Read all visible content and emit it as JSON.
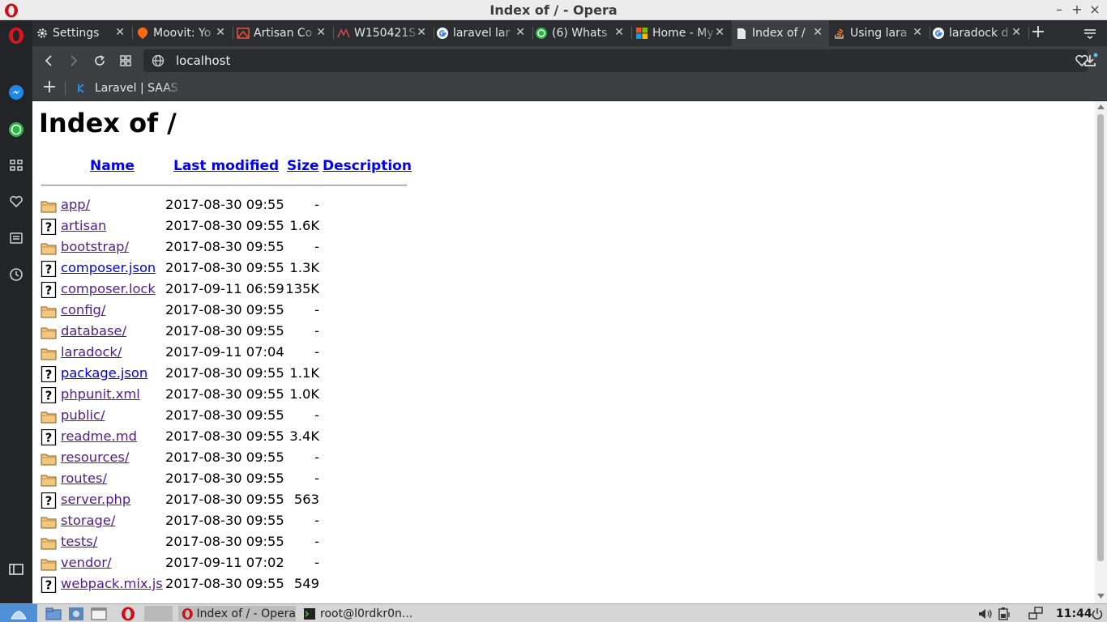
{
  "window": {
    "title": "Index of / - Opera",
    "minimize": "–",
    "maximize": "+",
    "close": "×"
  },
  "tabs": [
    {
      "label": "Settings",
      "icon": "gear-icon"
    },
    {
      "label": "Moovit: Yo",
      "icon": "moovit-icon"
    },
    {
      "label": "Artisan Co",
      "icon": "laravel-icon"
    },
    {
      "label": "W150421S",
      "icon": "generic-icon"
    },
    {
      "label": "laravel lar",
      "icon": "google-icon"
    },
    {
      "label": "(6) Whats",
      "icon": "whatsapp-icon"
    },
    {
      "label": "Home - My",
      "icon": "microsoft-icon"
    },
    {
      "label": "Index of /",
      "icon": "page-icon",
      "active": true
    },
    {
      "label": "Using lara",
      "icon": "stackoverflow-icon"
    },
    {
      "label": "laradock d",
      "icon": "google-icon"
    }
  ],
  "address_bar": {
    "url": "localhost"
  },
  "bookmarks": [
    {
      "label": "Laravel | SAAS U"
    }
  ],
  "listing": {
    "title": "Index of /",
    "columns": {
      "name": "Name",
      "last_modified": "Last modified",
      "size": "Size",
      "description": "Description"
    },
    "rows": [
      {
        "name": "app/",
        "date": "2017-08-30 09:55",
        "size": "-",
        "type": "folder",
        "visited": true
      },
      {
        "name": "artisan",
        "date": "2017-08-30 09:55",
        "size": "1.6K",
        "type": "file",
        "visited": true
      },
      {
        "name": "bootstrap/",
        "date": "2017-08-30 09:55",
        "size": "-",
        "type": "folder",
        "visited": true
      },
      {
        "name": "composer.json",
        "date": "2017-08-30 09:55",
        "size": "1.3K",
        "type": "file",
        "visited": false
      },
      {
        "name": "composer.lock",
        "date": "2017-09-11 06:59",
        "size": "135K",
        "type": "file",
        "visited": true
      },
      {
        "name": "config/",
        "date": "2017-08-30 09:55",
        "size": "-",
        "type": "folder",
        "visited": true
      },
      {
        "name": "database/",
        "date": "2017-08-30 09:55",
        "size": "-",
        "type": "folder",
        "visited": true
      },
      {
        "name": "laradock/",
        "date": "2017-09-11 07:04",
        "size": "-",
        "type": "folder",
        "visited": true
      },
      {
        "name": "package.json",
        "date": "2017-08-30 09:55",
        "size": "1.1K",
        "type": "file",
        "visited": false
      },
      {
        "name": "phpunit.xml",
        "date": "2017-08-30 09:55",
        "size": "1.0K",
        "type": "file",
        "visited": true
      },
      {
        "name": "public/",
        "date": "2017-08-30 09:55",
        "size": "-",
        "type": "folder",
        "visited": true
      },
      {
        "name": "readme.md",
        "date": "2017-08-30 09:55",
        "size": "3.4K",
        "type": "file",
        "visited": true
      },
      {
        "name": "resources/",
        "date": "2017-08-30 09:55",
        "size": "-",
        "type": "folder",
        "visited": true
      },
      {
        "name": "routes/",
        "date": "2017-08-30 09:55",
        "size": "-",
        "type": "folder",
        "visited": true
      },
      {
        "name": "server.php",
        "date": "2017-08-30 09:55",
        "size": "563",
        "type": "file",
        "visited": true
      },
      {
        "name": "storage/",
        "date": "2017-08-30 09:55",
        "size": "-",
        "type": "folder",
        "visited": true
      },
      {
        "name": "tests/",
        "date": "2017-08-30 09:55",
        "size": "-",
        "type": "folder",
        "visited": true
      },
      {
        "name": "vendor/",
        "date": "2017-09-11 07:02",
        "size": "-",
        "type": "folder",
        "visited": true
      },
      {
        "name": "webpack.mix.js",
        "date": "2017-08-30 09:55",
        "size": "549",
        "type": "file",
        "visited": true
      }
    ]
  },
  "taskbar": {
    "items": [
      {
        "label": "Index of / - Opera"
      },
      {
        "label": "root@l0rdkr0n..."
      }
    ],
    "clock": "11:44"
  },
  "colors": {
    "link_visited": "#551a8b",
    "link": "#0000ee",
    "opera_red": "#cc0f16"
  }
}
